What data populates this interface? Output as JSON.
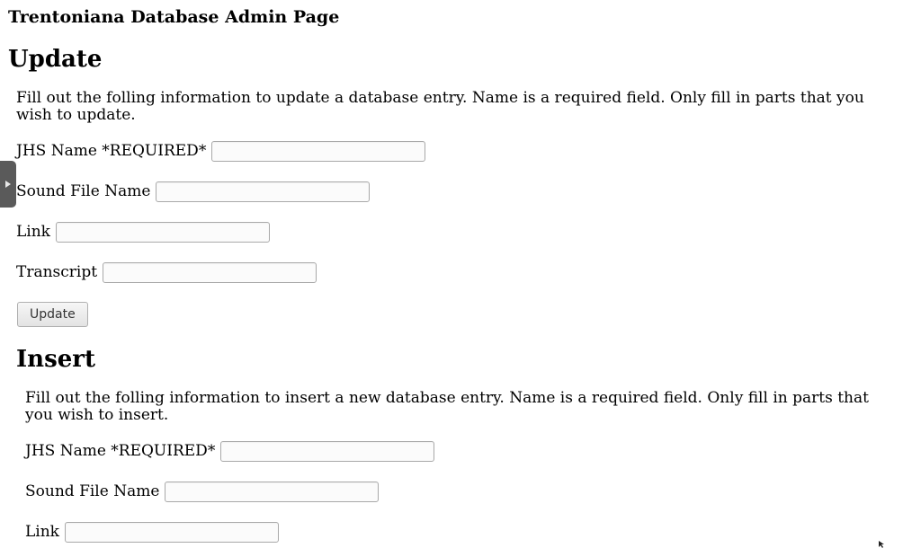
{
  "page_title": "Trentoniana Database Admin Page",
  "update": {
    "heading": "Update",
    "description": "Fill out the folling information to update a database entry. Name is a required field. Only fill in parts that you wish to update.",
    "fields": [
      {
        "label": "JHS Name *REQUIRED*",
        "value": ""
      },
      {
        "label": "Sound File Name",
        "value": ""
      },
      {
        "label": "Link",
        "value": ""
      },
      {
        "label": "Transcript",
        "value": ""
      }
    ],
    "button_label": "Update"
  },
  "insert": {
    "heading": "Insert",
    "description": "Fill out the folling information to insert a new database entry. Name is a required field. Only fill in parts that you wish to insert.",
    "fields": [
      {
        "label": "JHS Name *REQUIRED*",
        "value": ""
      },
      {
        "label": "Sound File Name",
        "value": ""
      },
      {
        "label": "Link",
        "value": ""
      }
    ]
  },
  "side_panel_toggle": {
    "icon": "triangle-right-icon",
    "color": "#5a5a5a"
  }
}
